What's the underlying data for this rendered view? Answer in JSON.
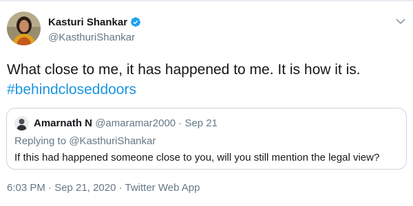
{
  "author": {
    "display_name": "Kasturi Shankar",
    "handle": "@KasthuriShankar",
    "verified": true
  },
  "tweet": {
    "text": "What close to me, it has happened to me.  It is how it is.",
    "hashtag": "#behindcloseddoors"
  },
  "quoted_tweet": {
    "display_name": "Amarnath N",
    "meta": "@amaramar2000 · Sep 21",
    "replying_to_prefix": "Replying to ",
    "replying_to_handle": "@KasthuriShankar",
    "text": "If this had happened someone close to you, will you still mention the legal view?"
  },
  "timestamp": "6:03 PM · Sep 21, 2020 · Twitter Web App",
  "colors": {
    "link": "#1b95e0",
    "secondary_text": "#657786",
    "verified_badge": "#1da1f2",
    "border": "#ccd6dd"
  },
  "icons": {
    "verified": "verified-badge-icon",
    "caret": "chevron-down-icon"
  }
}
